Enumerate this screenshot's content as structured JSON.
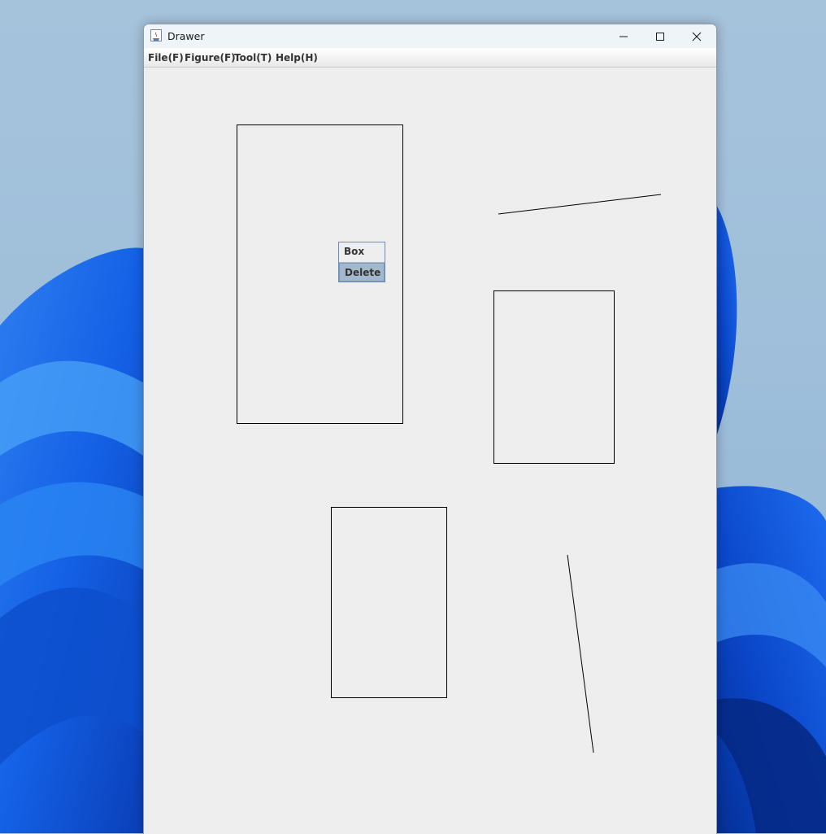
{
  "window": {
    "title": "Drawer"
  },
  "menu": {
    "items": [
      {
        "label": "File(F)"
      },
      {
        "label": "Figure(F)"
      },
      {
        "label": "Tool(T)"
      },
      {
        "label": "Help(H)"
      }
    ]
  },
  "context_menu": {
    "items": [
      {
        "label": "Box",
        "selected": false
      },
      {
        "label": "Delete",
        "selected": true
      }
    ]
  },
  "canvas": {
    "figures": [
      {
        "type": "rectangle"
      },
      {
        "type": "line"
      },
      {
        "type": "rectangle"
      },
      {
        "type": "rectangle"
      },
      {
        "type": "line"
      }
    ]
  },
  "colors": {
    "canvas_background": "#eeeeee",
    "figure_stroke": "#000000",
    "menu_selection": "#a3b8cc",
    "accent_border": "#6b8bbb"
  }
}
